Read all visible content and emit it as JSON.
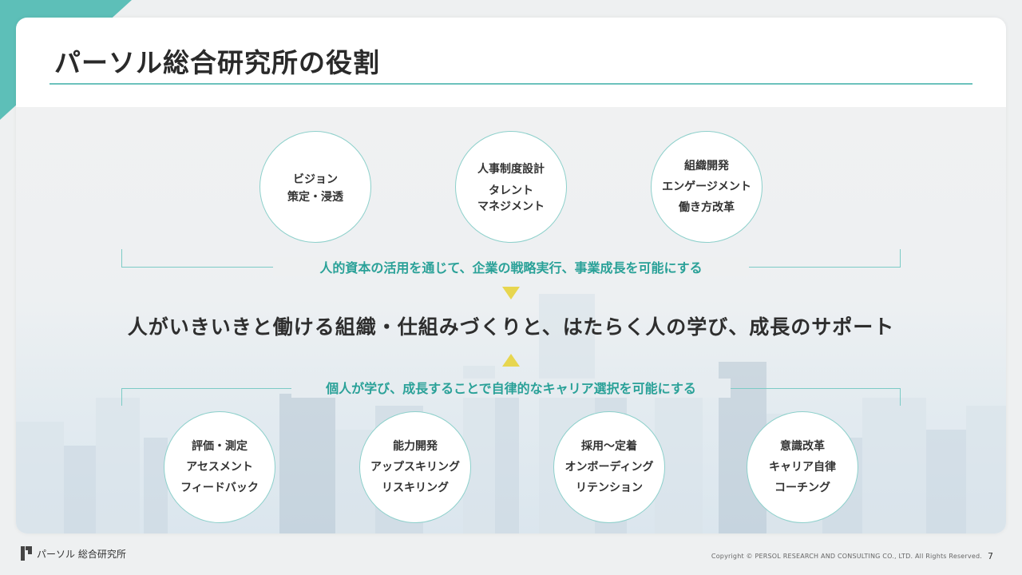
{
  "slide": {
    "title": "パーソル総合研究所の役割",
    "page_number": "7"
  },
  "top_circles": [
    {
      "lines": [
        "ビジョン",
        "策定・浸透"
      ]
    },
    {
      "line1": "人事制度設計",
      "line2": "タレント",
      "line3": "マネジメント"
    },
    {
      "lines": [
        "組織開発",
        "エンゲージメント",
        "働き方改革"
      ]
    }
  ],
  "top_bracket_label": "人的資本の活用を通じて、企業の戦略実行、事業成長を可能にする",
  "center_message": "人がいきいきと働ける組織・仕組みづくりと、はたらく人の学び、成長のサポート",
  "bottom_bracket_label": "個人が学び、成長することで自律的なキャリア選択を可能にする",
  "bottom_circles": [
    {
      "lines": [
        "評価・測定",
        "アセスメント",
        "フィードバック"
      ]
    },
    {
      "lines": [
        "能力開発",
        "アップスキリング",
        "リスキリング"
      ]
    },
    {
      "lines": [
        "採用〜定着",
        "オンボーディング",
        "リテンション"
      ]
    },
    {
      "lines": [
        "意識改革",
        "キャリア自律",
        "コーチング"
      ]
    }
  ],
  "footer": {
    "brand": "パーソル 総合研究所",
    "copyright": "Copyright © PERSOL RESEARCH AND CONSULTING CO., LTD. All Rights Reserved."
  },
  "colors": {
    "accent_teal": "#5dbfb8",
    "label_teal": "#2aa198",
    "triangle_yellow": "#e7d64f"
  }
}
